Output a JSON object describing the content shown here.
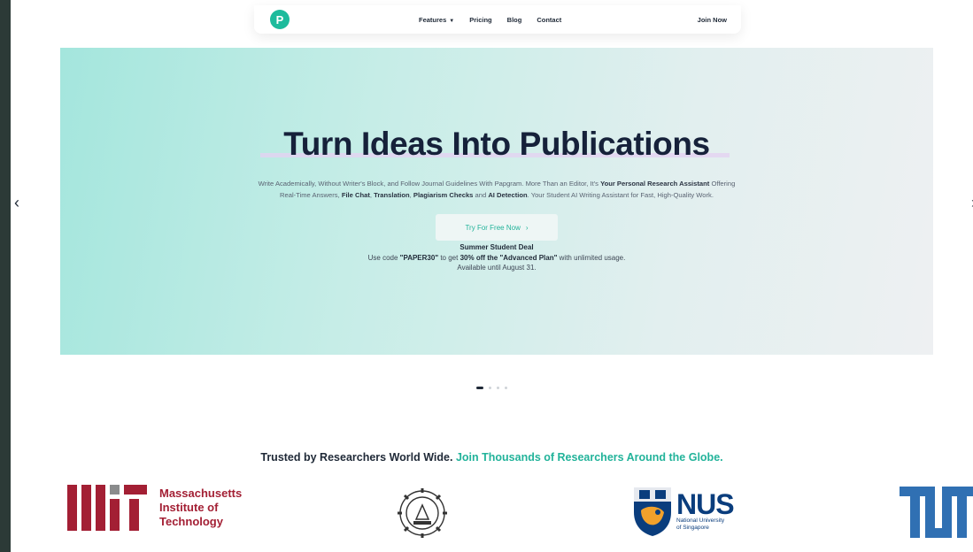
{
  "nav": {
    "logo_letter": "P",
    "items": [
      {
        "label": "Features",
        "has_dropdown": true
      },
      {
        "label": "Pricing"
      },
      {
        "label": "Blog"
      },
      {
        "label": "Contact"
      }
    ],
    "join_label": "Join Now"
  },
  "hero": {
    "title": "Turn Ideas Into Publications",
    "desc": {
      "p1": "Write Academically, Without Writer's Block, and Follow Journal Guidelines With Papgram. More Than an Editor, It's ",
      "b1": "Your Personal Research Assistant",
      "p2": " Offering Real-Time Answers, ",
      "b2": "File Chat",
      "p3": ", ",
      "b3": "Translation",
      "p4": ", ",
      "b4": "Plagiarism Checks",
      "p5": " and ",
      "b5": "AI Detection",
      "p6": ". Your Student AI Writing Assistant for Fast, High-Quality Work."
    },
    "cta_label": "Try For Free Now",
    "cta_chevron": "›",
    "deal": {
      "title": "Summer Student Deal",
      "l2_a": "Use code ",
      "l2_code": "\"PAPER30\"",
      "l2_b": " to get ",
      "l2_offer": "30% off the \"Advanced Plan\"",
      "l2_c": " with unlimited usage.",
      "l3": "Available until August 31."
    }
  },
  "carousel": {
    "prev_glyph": "‹",
    "next_glyph": "›",
    "slide_count": 4,
    "active_index": 0
  },
  "trusted": {
    "plain": "Trusted by Researchers World Wide.",
    "accent": "Join Thousands of Researchers Around the Globe."
  },
  "logos": {
    "mit": {
      "line1": "Massachusetts",
      "line2": "Institute of",
      "line3": "Technology"
    },
    "nus": {
      "big": "NUS",
      "small1": "National University",
      "small2": "of Singapore"
    }
  },
  "colors": {
    "accent": "#22b39a",
    "logo": "#1dbb9c",
    "mit_red": "#a31f34",
    "nus_blue": "#0a3d7d",
    "tum_blue": "#3070b3"
  }
}
